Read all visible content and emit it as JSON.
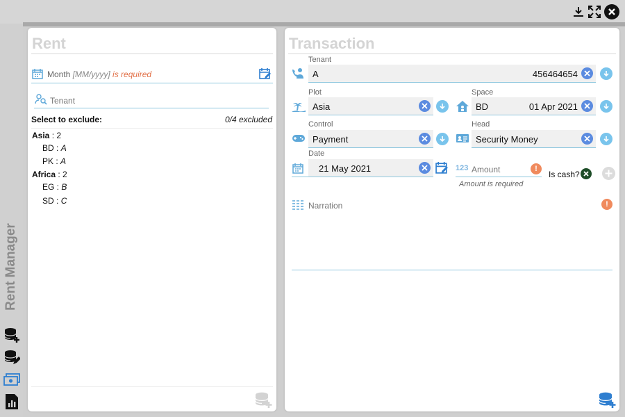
{
  "window": {
    "app_title": "Rent Manager",
    "titlebar_icons": [
      "download-icon",
      "fullscreen-icon",
      "close-icon"
    ]
  },
  "sidebar": {
    "buttons": [
      {
        "name": "add-database-icon"
      },
      {
        "name": "edit-database-icon"
      },
      {
        "name": "money-icon"
      },
      {
        "name": "report-icon"
      }
    ]
  },
  "rent": {
    "title": "Rent",
    "month": {
      "label": "Month",
      "format": "[MM/yyyy]",
      "required": "is required"
    },
    "tenant_placeholder": "Tenant",
    "exclude_label": "Select to exclude:",
    "excluded_count": "0/4 excluded",
    "groups": [
      {
        "name": "Asia",
        "count": "2",
        "items": [
          {
            "code": "BD",
            "value": "A"
          },
          {
            "code": "PK",
            "value": "A"
          }
        ]
      },
      {
        "name": "Africa",
        "count": "2",
        "items": [
          {
            "code": "EG",
            "value": "B"
          },
          {
            "code": "SD",
            "value": "C"
          }
        ]
      }
    ]
  },
  "transaction": {
    "title": "Transaction",
    "tenant": {
      "label": "Tenant",
      "value": "A",
      "phone": "456464654"
    },
    "plot": {
      "label": "Plot",
      "value": "Asia"
    },
    "space": {
      "label": "Space",
      "value": "BD",
      "date": "01 Apr 2021"
    },
    "control": {
      "label": "Control",
      "value": "Payment"
    },
    "head": {
      "label": "Head",
      "value": "Security Money"
    },
    "date": {
      "label": "Date",
      "value": "21 May 2021"
    },
    "amount": {
      "placeholder": "Amount",
      "prefix": "123",
      "error": "Amount is required"
    },
    "is_cash": "Is cash?",
    "narration_placeholder": "Narration"
  },
  "colors": {
    "accent": "#5b8be0",
    "accent_light": "#79c4ec",
    "warning": "#f08a5d",
    "title_muted": "#d4d4d4"
  }
}
